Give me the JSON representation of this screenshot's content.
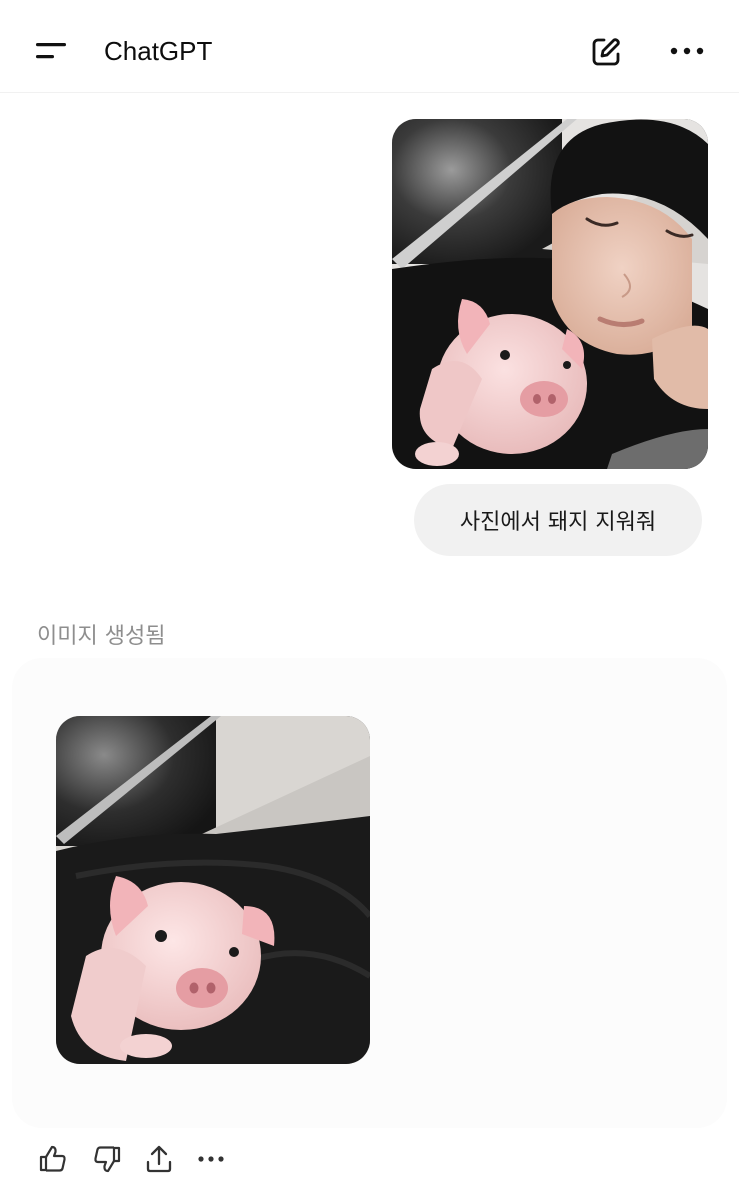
{
  "header": {
    "title": "ChatGPT",
    "menu_icon": "menu-icon",
    "new_chat_icon": "compose-icon",
    "more_icon": "more-icon"
  },
  "conversation": {
    "user_message": {
      "attachment": "photo of a man sleeping with a piglet on his chest",
      "text": "사진에서 돼지 지워줘"
    },
    "assistant_message": {
      "status_label": "이미지 생성됨",
      "image": "generated image with the pig on a dark cushion"
    },
    "actions": [
      {
        "icon": "thumbs-up-icon"
      },
      {
        "icon": "thumbs-down-icon"
      },
      {
        "icon": "share-icon"
      },
      {
        "icon": "more-icon"
      }
    ]
  },
  "colors": {
    "bubble": "#f1f1f1",
    "muted_text": "#8e8e8e",
    "icon": "#111111"
  }
}
